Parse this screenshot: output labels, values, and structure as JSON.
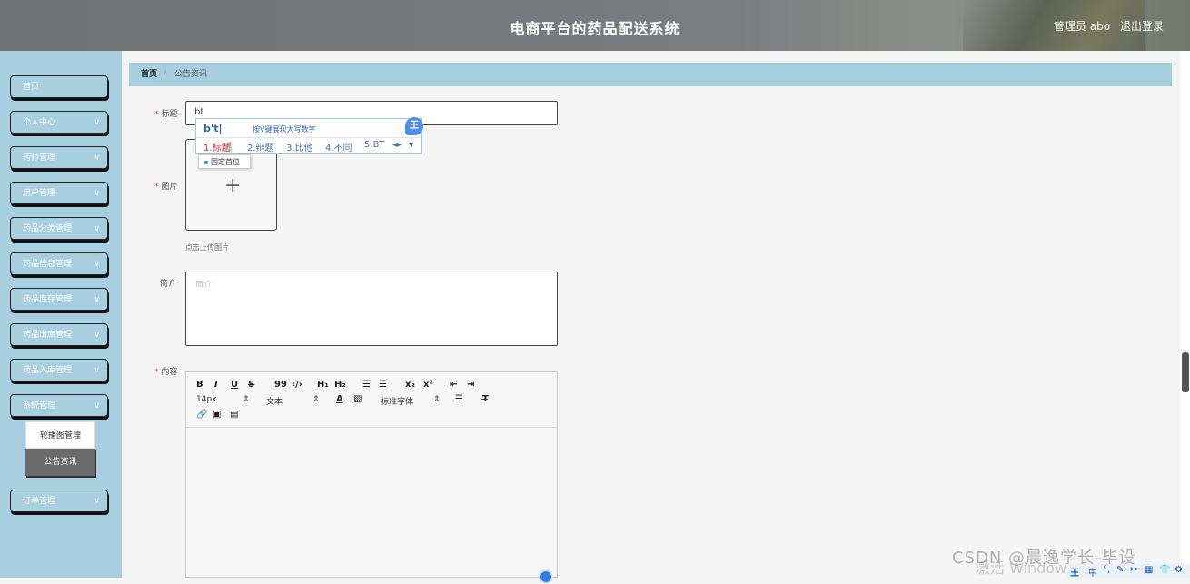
{
  "header": {
    "title": "电商平台的药品配送系统",
    "user": "管理员 abo",
    "logout": "退出登录"
  },
  "sidebar": {
    "items": [
      {
        "label": "首页",
        "expandable": false
      },
      {
        "label": "个人中心",
        "expandable": true
      },
      {
        "label": "药师管理",
        "expandable": true
      },
      {
        "label": "用户管理",
        "expandable": true
      },
      {
        "label": "药品分类管理",
        "expandable": true
      },
      {
        "label": "药品信息管理",
        "expandable": true
      },
      {
        "label": "药品库存管理",
        "expandable": true
      },
      {
        "label": "药品出库管理",
        "expandable": true
      },
      {
        "label": "药品入库管理",
        "expandable": true
      },
      {
        "label": "系统管理",
        "expandable": true
      },
      {
        "label": "订单管理",
        "expandable": true
      }
    ],
    "submenu": [
      "轮播图管理",
      "公告资讯"
    ],
    "chevron": "∨"
  },
  "breadcrumb": {
    "home": "首页",
    "separator": "/",
    "current": "公告资讯"
  },
  "form": {
    "title_label": "标题",
    "title_value": "bt",
    "image_label": "图片",
    "upload_plus": "+",
    "upload_hint": "点击上传图片",
    "intro_label": "简介",
    "intro_placeholder": "简介",
    "content_label": "内容",
    "required_mark": "*"
  },
  "editor_toolbar": {
    "row1": [
      "B",
      "I",
      "U",
      "S",
      "99",
      "‹/›",
      "H₁",
      "H₂",
      "☰",
      "☰",
      "x₂",
      "x²",
      "⇤",
      "⇥"
    ],
    "font_size": "14px",
    "text_type": "文本",
    "font_family": "标准字体",
    "select_arrow": "⇕"
  },
  "ime": {
    "composition": "b't|",
    "hint": "按V键展现大写数字",
    "candidates": [
      "1.标题",
      "2.辩题",
      "3.比他",
      "4.不同",
      "5.BT"
    ],
    "badge": "王",
    "tooltip": "固定首位"
  },
  "overlay": {
    "watermark": "CSDN @晨逸学长-毕设",
    "activate": "激活 Windows"
  },
  "tray": {
    "items": [
      "王",
      "中",
      "°,",
      "✎",
      "✂",
      "▦",
      "👕",
      "⚙"
    ]
  }
}
